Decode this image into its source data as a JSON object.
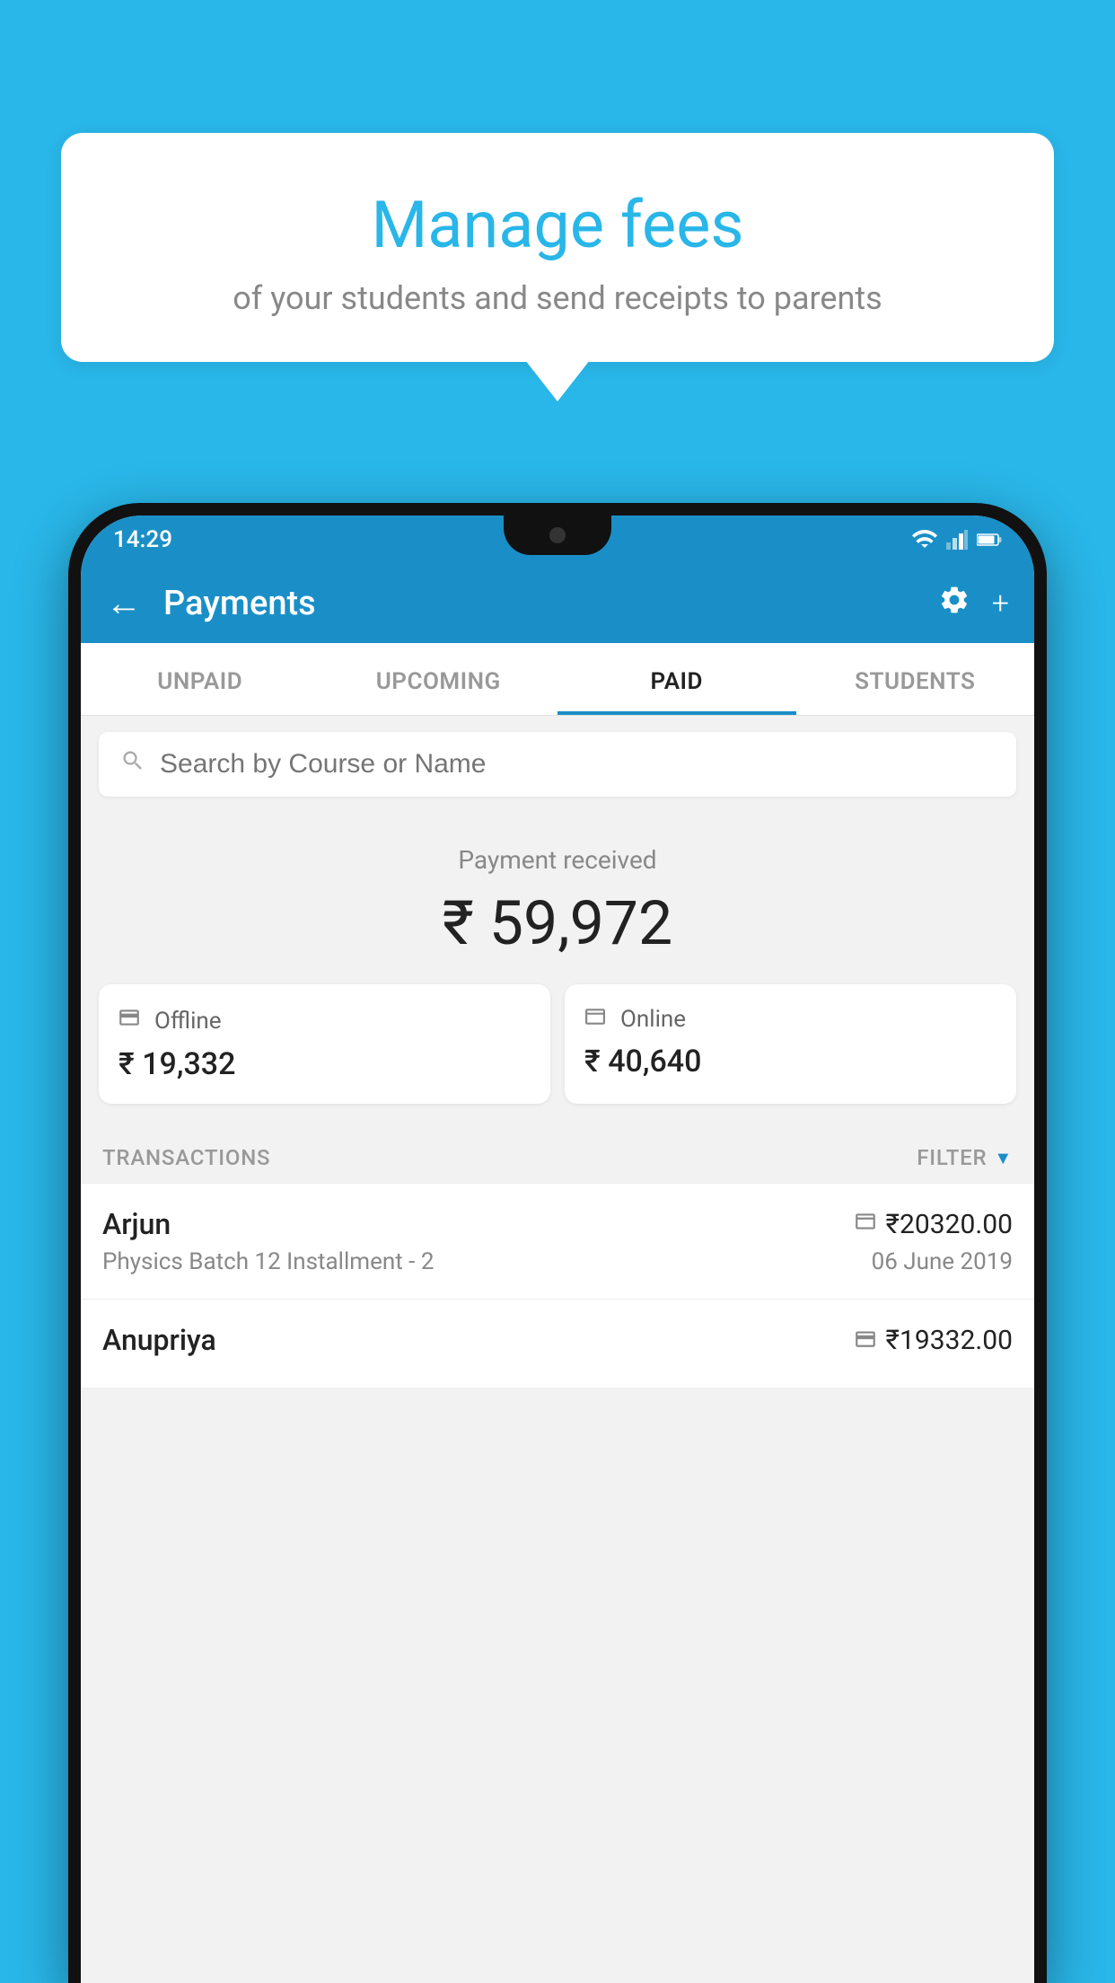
{
  "background_color": "#29b6e8",
  "speech_bubble": {
    "title": "Manage fees",
    "subtitle": "of your students and send receipts to parents"
  },
  "status_bar": {
    "time": "14:29"
  },
  "app_bar": {
    "title": "Payments",
    "back_icon": "←",
    "settings_icon": "⚙",
    "plus_icon": "+"
  },
  "tabs": [
    {
      "label": "UNPAID",
      "active": false
    },
    {
      "label": "UPCOMING",
      "active": false
    },
    {
      "label": "PAID",
      "active": true
    },
    {
      "label": "STUDENTS",
      "active": false
    }
  ],
  "search": {
    "placeholder": "Search by Course or Name"
  },
  "payment_received": {
    "label": "Payment received",
    "amount": "₹ 59,972"
  },
  "cards": [
    {
      "type": "Offline",
      "amount": "₹ 19,332",
      "icon": "💳"
    },
    {
      "type": "Online",
      "amount": "₹ 40,640",
      "icon": "🪪"
    }
  ],
  "transactions_section": {
    "label": "TRANSACTIONS",
    "filter_label": "FILTER"
  },
  "transactions": [
    {
      "name": "Arjun",
      "course": "Physics Batch 12 Installment - 2",
      "amount": "₹20320.00",
      "date": "06 June 2019",
      "payment_type": "online"
    },
    {
      "name": "Anupriya",
      "course": "",
      "amount": "₹19332.00",
      "date": "",
      "payment_type": "offline"
    }
  ]
}
